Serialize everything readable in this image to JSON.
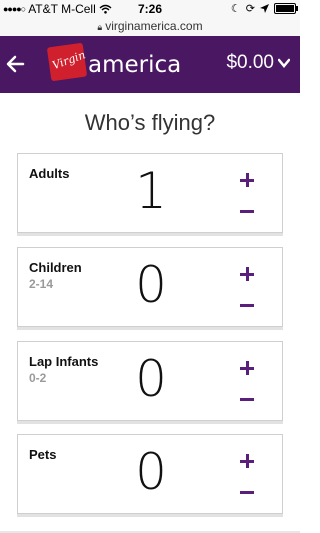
{
  "status_bar": {
    "carrier": "AT&T M-Cell",
    "time": "7:26",
    "url": "virginamerica.com"
  },
  "header": {
    "logo_script": "Virgin",
    "logo_word": "america",
    "balance": "$0.00"
  },
  "title": "Who’s flying?",
  "passengers": [
    {
      "label": "Adults",
      "sub": "",
      "count": "1"
    },
    {
      "label": "Children",
      "sub": "2-14",
      "count": "0"
    },
    {
      "label": "Lap Infants",
      "sub": "0-2",
      "count": "0"
    },
    {
      "label": "Pets",
      "sub": "",
      "count": "0"
    }
  ],
  "colors": {
    "header_bg": "#4a1763",
    "accent": "#5a1f7a",
    "logo_red": "#d0202e"
  },
  "icons": [
    "signal-dots-icon",
    "wifi-icon",
    "moon-icon",
    "rotation-lock-icon",
    "location-icon",
    "battery-icon",
    "lock-icon",
    "back-arrow-icon",
    "chevron-down-icon",
    "plus-icon",
    "minus-icon"
  ]
}
